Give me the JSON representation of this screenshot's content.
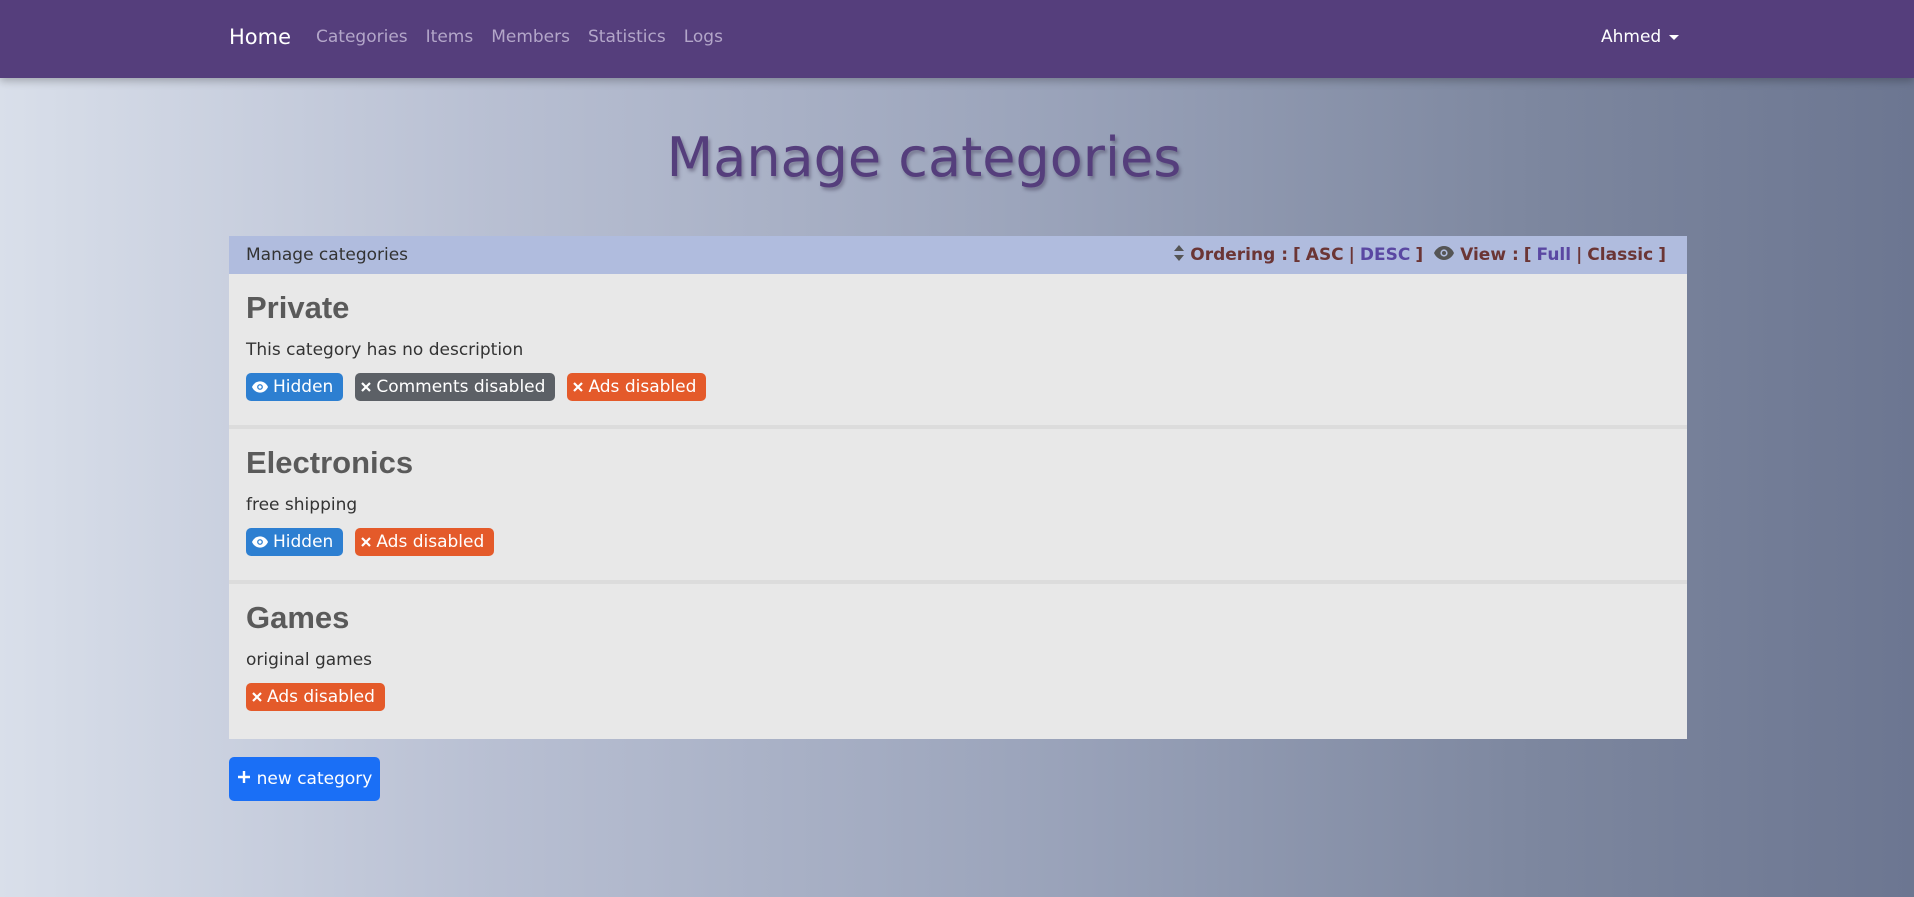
{
  "navbar": {
    "brand": "Home",
    "links": [
      "Categories",
      "Items",
      "Members",
      "Statistics",
      "Logs"
    ],
    "user": "Ahmed",
    "bg_color": "#553e7c"
  },
  "page_title": "Manage categories",
  "panel": {
    "title": "Manage categories",
    "ordering_label": "Ordering :",
    "asc": "ASC",
    "desc": "DESC",
    "view_label": "View :",
    "full": "Full",
    "classic": "Classic",
    "open_bracket": "[",
    "close_bracket": "]",
    "pipe": "|"
  },
  "categories": [
    {
      "name": "Private",
      "description": "This category has no description",
      "badges": [
        "Hidden",
        "Comments disabled",
        "Ads disabled"
      ]
    },
    {
      "name": "Electronics",
      "description": "free shipping",
      "badges": [
        "Hidden",
        "Ads disabled"
      ]
    },
    {
      "name": "Games",
      "description": "original games",
      "badges": [
        "Ads disabled"
      ]
    }
  ],
  "new_button": "new category",
  "colors": {
    "hidden_badge": "#2d7fd1",
    "comments_badge": "#5c6066",
    "ads_badge": "#e45a2a",
    "new_button": "#1a6ff6"
  }
}
